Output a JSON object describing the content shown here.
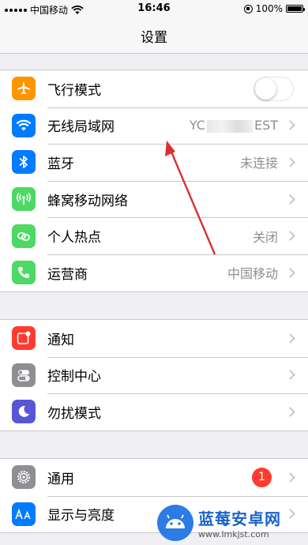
{
  "status_bar": {
    "carrier": "中国移动",
    "time": "16:46",
    "battery": "100%"
  },
  "nav": {
    "title": "设置"
  },
  "groups": [
    {
      "rows": [
        {
          "label": "飞行模式",
          "icon": "airplane-icon",
          "color": "#ff9500",
          "toggle_on": false
        },
        {
          "label": "无线局域网",
          "icon": "wifi-icon",
          "color": "#007aff",
          "value_prefix": "YC",
          "value_suffix": "EST"
        },
        {
          "label": "蓝牙",
          "icon": "bluetooth-icon",
          "color": "#007aff",
          "value": "未连接"
        },
        {
          "label": "蜂窝移动网络",
          "icon": "cellular-icon",
          "color": "#4cd964"
        },
        {
          "label": "个人热点",
          "icon": "hotspot-icon",
          "color": "#4cd964",
          "value": "关闭"
        },
        {
          "label": "运营商",
          "icon": "phone-icon",
          "color": "#4cd964",
          "value": "中国移动"
        }
      ]
    },
    {
      "rows": [
        {
          "label": "通知",
          "icon": "notifications-icon",
          "color": "#ff3b30"
        },
        {
          "label": "控制中心",
          "icon": "control-center-icon",
          "color": "#8e8e93"
        },
        {
          "label": "勿扰模式",
          "icon": "moon-icon",
          "color": "#5856d6"
        }
      ]
    },
    {
      "rows": [
        {
          "label": "通用",
          "icon": "gear-icon",
          "color": "#8e8e93",
          "badge": "1"
        },
        {
          "label": "显示与亮度",
          "icon": "display-icon",
          "color": "#007aff"
        }
      ]
    }
  ],
  "watermark": {
    "title": "蓝莓安卓网",
    "url": "www.lmkjst.com"
  }
}
